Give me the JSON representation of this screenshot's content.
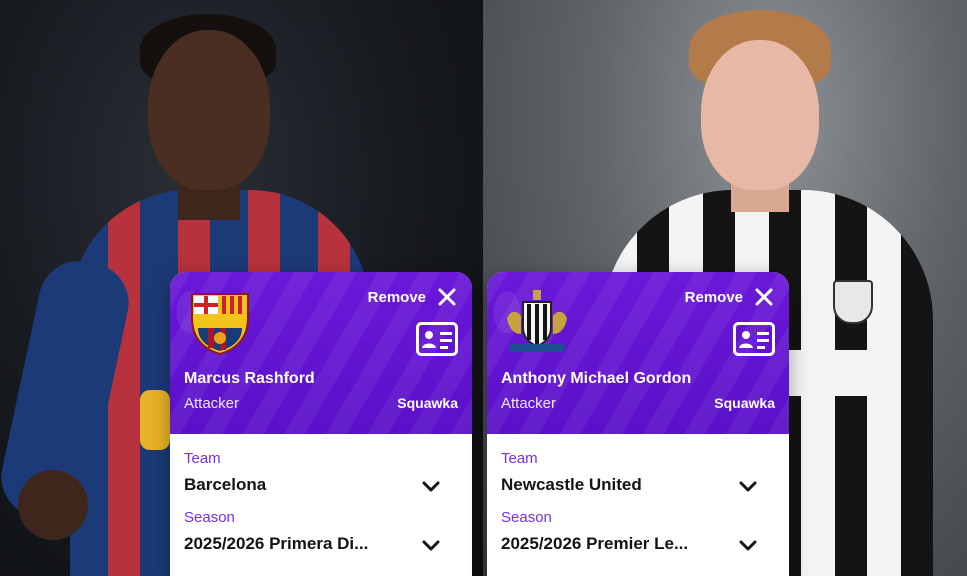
{
  "cards": [
    {
      "remove_label": "Remove",
      "name": "Marcus Rashford",
      "position": "Attacker",
      "source": "Squawka",
      "team_label": "Team",
      "team_value": "Barcelona",
      "season_label": "Season",
      "season_value": "2025/2026 Primera Di...",
      "crest_icon": "fc-barcelona-crest-icon"
    },
    {
      "remove_label": "Remove",
      "name": "Anthony Michael Gordon",
      "position": "Attacker",
      "source": "Squawka",
      "team_label": "Team",
      "team_value": "Newcastle United",
      "season_label": "Season",
      "season_value": "2025/2026 Premier Le...",
      "crest_icon": "newcastle-united-crest-icon"
    }
  ],
  "colors": {
    "card_header": "#6b18d8",
    "label_purple": "#7a2ee0",
    "value_text": "#141414"
  }
}
